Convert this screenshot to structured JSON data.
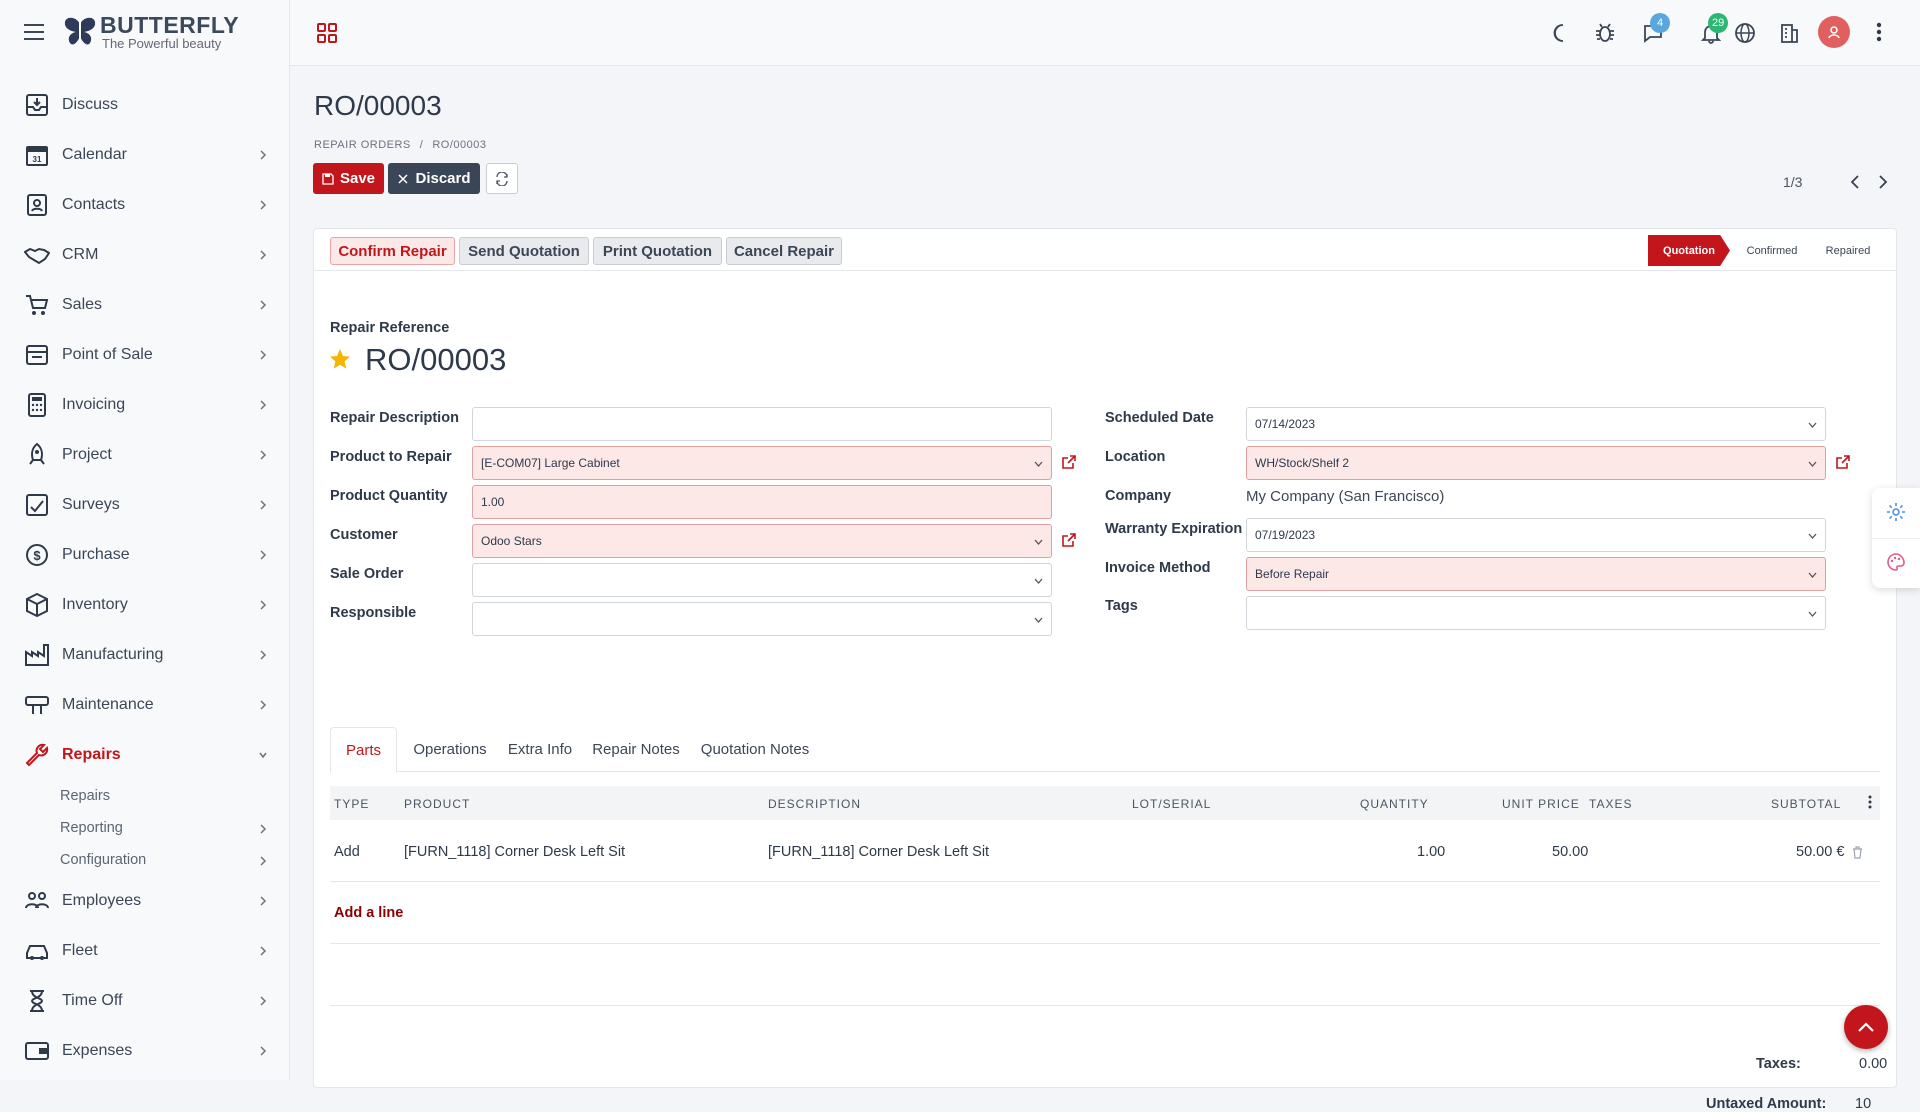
{
  "brand": {
    "name": "BUTTERFLY",
    "tagline": "The Powerful beauty"
  },
  "sidebar": {
    "items": [
      {
        "label": "Discuss",
        "icon": "discuss-icon"
      },
      {
        "label": "Calendar",
        "icon": "calendar-icon"
      },
      {
        "label": "Contacts",
        "icon": "contacts-icon"
      },
      {
        "label": "CRM",
        "icon": "handshake-icon"
      },
      {
        "label": "Sales",
        "icon": "cart-icon"
      },
      {
        "label": "Point of Sale",
        "icon": "store-icon"
      },
      {
        "label": "Invoicing",
        "icon": "calculator-icon"
      },
      {
        "label": "Project",
        "icon": "rocket-icon"
      },
      {
        "label": "Surveys",
        "icon": "survey-icon"
      },
      {
        "label": "Purchase",
        "icon": "dollar-icon"
      },
      {
        "label": "Inventory",
        "icon": "box-icon"
      },
      {
        "label": "Manufacturing",
        "icon": "factory-icon"
      },
      {
        "label": "Maintenance",
        "icon": "tools-icon"
      },
      {
        "label": "Repairs",
        "icon": "wrench-icon"
      },
      {
        "label": "Employees",
        "icon": "employees-icon"
      },
      {
        "label": "Fleet",
        "icon": "car-icon"
      },
      {
        "label": "Time Off",
        "icon": "hourglass-icon"
      },
      {
        "label": "Expenses",
        "icon": "wallet-icon"
      }
    ],
    "repairs_sub": [
      {
        "label": "Repairs"
      },
      {
        "label": "Reporting"
      },
      {
        "label": "Configuration"
      }
    ]
  },
  "topbar": {
    "messages_badge": "4",
    "notifications_badge": "29"
  },
  "page": {
    "title": "RO/00003",
    "breadcrumb_root": "REPAIR ORDERS",
    "breadcrumb_sep": "/",
    "breadcrumb_current": "RO/00003",
    "save_label": "Save",
    "discard_label": "Discard",
    "pager": "1/3"
  },
  "statusbar": {
    "confirm": "Confirm Repair",
    "send": "Send Quotation",
    "print": "Print Quotation",
    "cancel": "Cancel Repair",
    "stages": [
      "Quotation",
      "Confirmed",
      "Repaired"
    ],
    "active_stage": "Quotation"
  },
  "form": {
    "ref_label": "Repair Reference",
    "ref_value": "RO/00003",
    "left": {
      "repair_description": {
        "label": "Repair Description",
        "value": ""
      },
      "product": {
        "label": "Product to Repair",
        "value": "[E-COM07] Large Cabinet"
      },
      "quantity": {
        "label": "Product Quantity",
        "value": "1.00"
      },
      "customer": {
        "label": "Customer",
        "value": "Odoo Stars"
      },
      "sale_order": {
        "label": "Sale Order",
        "value": ""
      },
      "responsible": {
        "label": "Responsible",
        "value": ""
      }
    },
    "right": {
      "scheduled_date": {
        "label": "Scheduled Date",
        "value": "07/14/2023"
      },
      "location": {
        "label": "Location",
        "value": "WH/Stock/Shelf 2"
      },
      "company": {
        "label": "Company",
        "value": "My Company (San Francisco)"
      },
      "warranty": {
        "label": "Warranty Expiration",
        "value": "07/19/2023"
      },
      "invoice_method": {
        "label": "Invoice Method",
        "value": "Before Repair"
      },
      "tags": {
        "label": "Tags",
        "value": ""
      }
    }
  },
  "tabs": [
    "Parts",
    "Operations",
    "Extra Info",
    "Repair Notes",
    "Quotation Notes"
  ],
  "table": {
    "headers": [
      "TYPE",
      "PRODUCT",
      "DESCRIPTION",
      "LOT/SERIAL",
      "QUANTITY",
      "UNIT PRICE",
      "TAXES",
      "SUBTOTAL"
    ],
    "rows": [
      {
        "type": "Add",
        "product": "[FURN_1118] Corner Desk Left Sit",
        "description": "[FURN_1118] Corner Desk Left Sit",
        "lot": "",
        "quantity": "1.00",
        "unit_price": "50.00",
        "taxes": "",
        "subtotal": "50.00 €"
      }
    ],
    "add_line": "Add a line"
  },
  "totals": {
    "untaxed_label": "Untaxed Amount:",
    "untaxed_value": "10",
    "taxes_label": "Taxes:",
    "taxes_value": "0.00"
  },
  "colors": {
    "accent": "#c3161c",
    "badge_blue": "#5aa7e0",
    "badge_green": "#2bb673"
  }
}
